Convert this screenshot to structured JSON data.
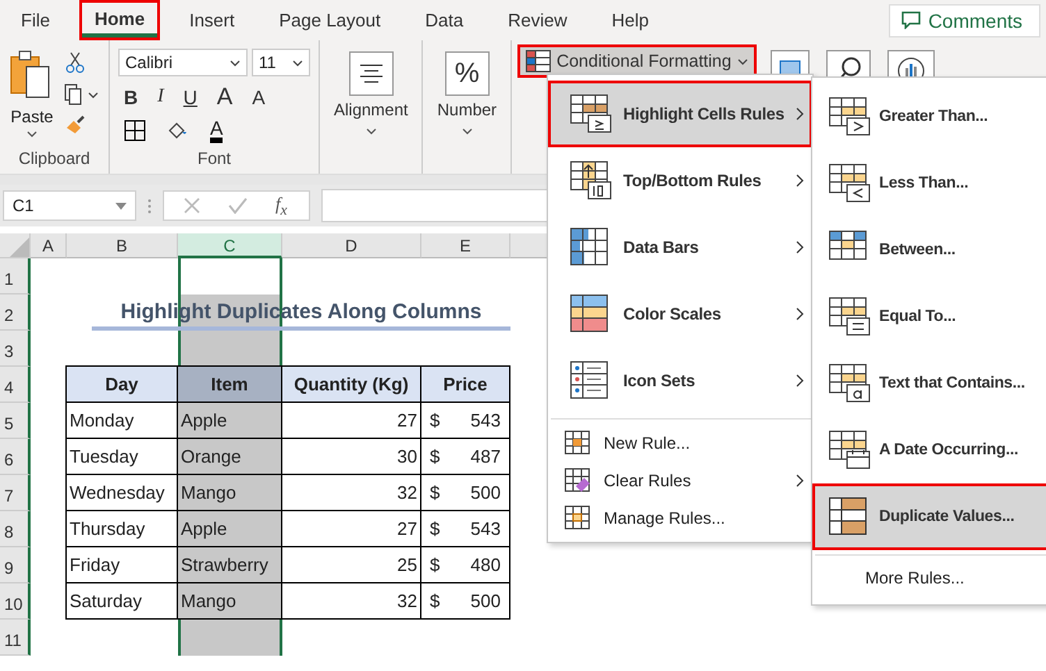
{
  "tabs": [
    {
      "label": "File",
      "selected": false,
      "callout": false
    },
    {
      "label": "Home",
      "selected": true,
      "callout": true
    },
    {
      "label": "Insert",
      "selected": false,
      "callout": false
    },
    {
      "label": "Page Layout",
      "selected": false,
      "callout": false
    },
    {
      "label": "Data",
      "selected": false,
      "callout": false
    },
    {
      "label": "Review",
      "selected": false,
      "callout": false
    },
    {
      "label": "Help",
      "selected": false,
      "callout": false
    }
  ],
  "comments_button": "Comments",
  "ribbon": {
    "clipboard": {
      "paste": "Paste",
      "label": "Clipboard"
    },
    "font": {
      "name": "Calibri",
      "size": "11",
      "bold": "B",
      "italic": "I",
      "underline": "U",
      "grow": "A",
      "shrink": "A",
      "color_letter": "A",
      "label": "Font"
    },
    "alignment": "Alignment",
    "number_icon": "%",
    "number": "Number",
    "conditional_formatting": {
      "label": "Conditional Formatting",
      "expanded": true,
      "callout": true
    }
  },
  "formula_bar": {
    "name_box": "C1",
    "fx": "f$_{x}$"
  },
  "sheet": {
    "columns": [
      {
        "label": "A",
        "selected": false
      },
      {
        "label": "B",
        "selected": false
      },
      {
        "label": "C",
        "selected": true
      },
      {
        "label": "D",
        "selected": false
      },
      {
        "label": "E",
        "selected": false
      }
    ],
    "rows": [
      "1",
      "2",
      "3",
      "4",
      "5",
      "6",
      "7",
      "8",
      "9",
      "10",
      "11"
    ],
    "title": "Highlight Duplicates Along Columns",
    "headers": [
      "Day",
      "Item",
      "Quantity (Kg)",
      "Price"
    ],
    "data": [
      {
        "day": "Monday",
        "item": "Apple",
        "quantity": "27",
        "currency": "$",
        "price": "543"
      },
      {
        "day": "Tuesday",
        "item": "Orange",
        "quantity": "30",
        "currency": "$",
        "price": "487"
      },
      {
        "day": "Wednesday",
        "item": "Mango",
        "quantity": "32",
        "currency": "$",
        "price": "500"
      },
      {
        "day": "Thursday",
        "item": "Apple",
        "quantity": "27",
        "currency": "$",
        "price": "543"
      },
      {
        "day": "Friday",
        "item": "Strawberry",
        "quantity": "25",
        "currency": "$",
        "price": "480"
      },
      {
        "day": "Saturday",
        "item": "Mango",
        "quantity": "32",
        "currency": "$",
        "price": "500"
      }
    ]
  },
  "menu": {
    "items": [
      {
        "kind": "large",
        "label": "Highlight Cells Rules",
        "submenu": true,
        "selected": true,
        "callout": true
      },
      {
        "kind": "large",
        "label": "Top/Bottom Rules",
        "submenu": true,
        "selected": false,
        "callout": false
      },
      {
        "kind": "large",
        "label": "Data Bars",
        "submenu": true,
        "selected": false,
        "callout": false
      },
      {
        "kind": "large",
        "label": "Color Scales",
        "submenu": true,
        "selected": false,
        "callout": false
      },
      {
        "kind": "large",
        "label": "Icon Sets",
        "submenu": true,
        "selected": false,
        "callout": false
      },
      {
        "kind": "small",
        "label": "New Rule...",
        "submenu": false,
        "selected": false,
        "callout": false
      },
      {
        "kind": "small",
        "label": "Clear Rules",
        "submenu": true,
        "selected": false,
        "callout": false
      },
      {
        "kind": "small",
        "label": "Manage Rules...",
        "submenu": false,
        "selected": false,
        "callout": false
      }
    ]
  },
  "submenu": {
    "items": [
      {
        "kind": "large",
        "label": "Greater Than...",
        "selected": false,
        "callout": false
      },
      {
        "kind": "large",
        "label": "Less Than...",
        "selected": false,
        "callout": false
      },
      {
        "kind": "large",
        "label": "Between...",
        "selected": false,
        "callout": false
      },
      {
        "kind": "large",
        "label": "Equal To...",
        "selected": false,
        "callout": false
      },
      {
        "kind": "large",
        "label": "Text that Contains...",
        "selected": false,
        "callout": false
      },
      {
        "kind": "large",
        "label": "A Date Occurring...",
        "selected": false,
        "callout": false
      },
      {
        "kind": "large",
        "label": "Duplicate Values...",
        "selected": true,
        "callout": true
      },
      {
        "kind": "text",
        "label": "More Rules...",
        "selected": false,
        "callout": false
      }
    ]
  }
}
